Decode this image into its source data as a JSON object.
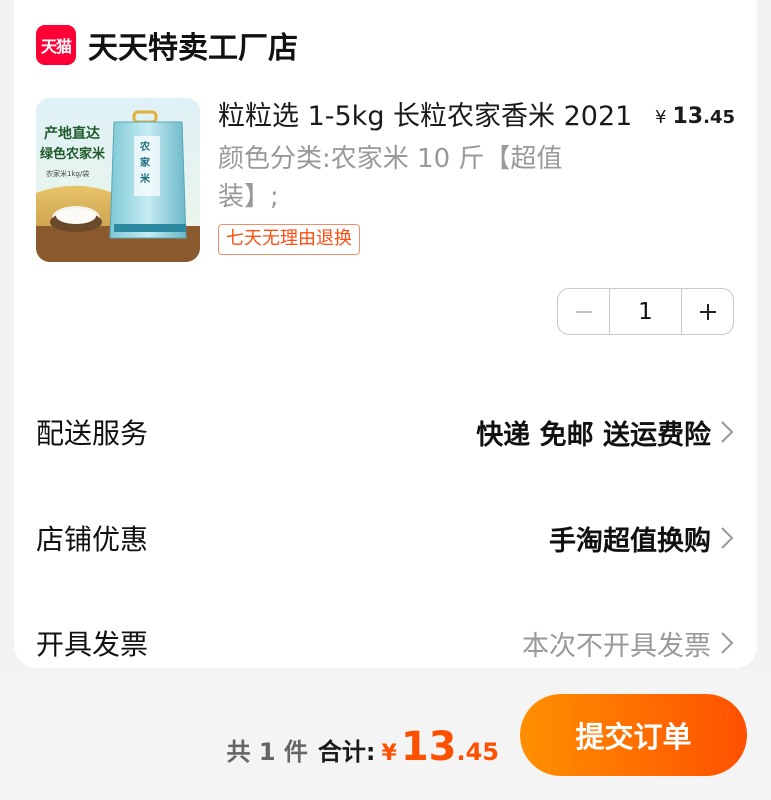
{
  "store": {
    "logo_text": "天猫",
    "name": "天天特卖工厂店",
    "brand_color": "#ff0036"
  },
  "product": {
    "image_texts": [
      "产地直达",
      "绿色农家米",
      "农家米1kg/袋",
      "农家米"
    ],
    "title": "粒粒选 1-5kg 长粒农家香米 2021",
    "price_symbol": "¥",
    "price_int": "13",
    "price_dec": ".45",
    "variant": "颜色分类:农家米 10 斤【超值装】;",
    "return_badge": "七天无理由退换",
    "quantity": "1",
    "minus_icon": "minus-icon",
    "plus_icon": "plus-icon"
  },
  "rows": {
    "delivery": {
      "label": "配送服务",
      "value": "快递 免邮 送运费险"
    },
    "discount": {
      "label": "店铺优惠",
      "value": "手淘超值换购"
    },
    "invoice": {
      "label": "开具发票",
      "value": "本次不开具发票"
    }
  },
  "footer": {
    "count": "共 1 件",
    "total_label": "合计:",
    "total_symbol": "¥",
    "total_int": "13",
    "total_dec": ".45",
    "submit_label": "提交订单",
    "accent_color": "#ff5000"
  }
}
